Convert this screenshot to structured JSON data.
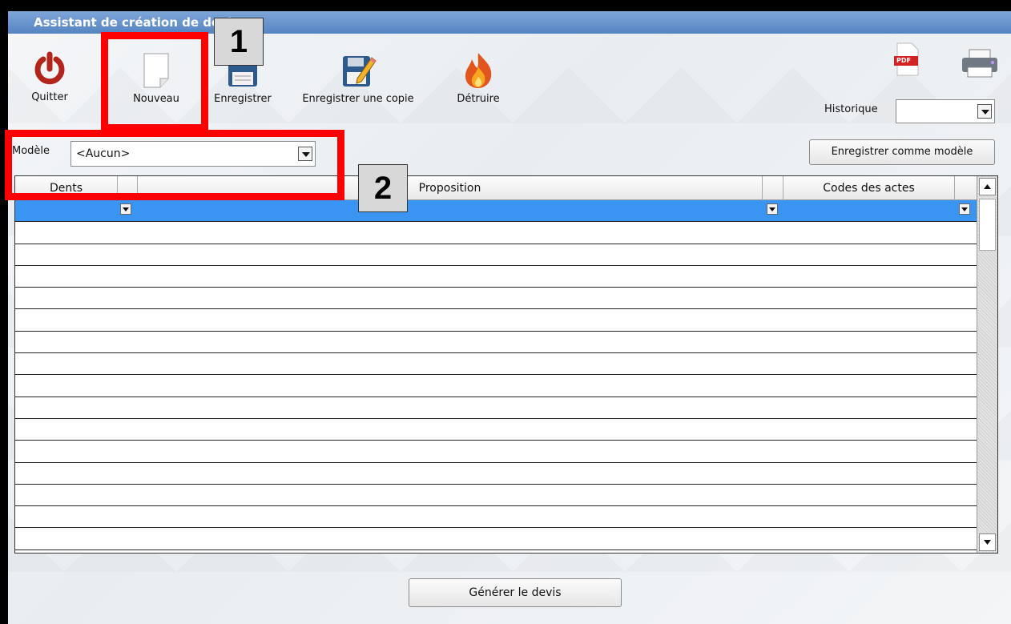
{
  "window": {
    "title": "Assistant de création de devis"
  },
  "toolbar": {
    "quit_label": "Quitter",
    "new_label": "Nouveau",
    "save_label": "Enregistrer",
    "save_copy_label": "Enregistrer une copie",
    "destroy_label": "Détruire",
    "pdf_badge": "PDF"
  },
  "history": {
    "label": "Historique",
    "value": ""
  },
  "model": {
    "label": "Modèle",
    "value": "<Aucun>"
  },
  "save_as_model_button": "Enregistrer comme modèle",
  "grid": {
    "columns": [
      "Dents",
      "Proposition",
      "Codes des actes"
    ],
    "row_count": 16
  },
  "generate_button": "Générer le devis",
  "callouts": {
    "one": "1",
    "two": "2"
  },
  "colors": {
    "selected_row": "#3a95f2",
    "title_bar": "#5584c2",
    "highlight": "#ff0000"
  }
}
